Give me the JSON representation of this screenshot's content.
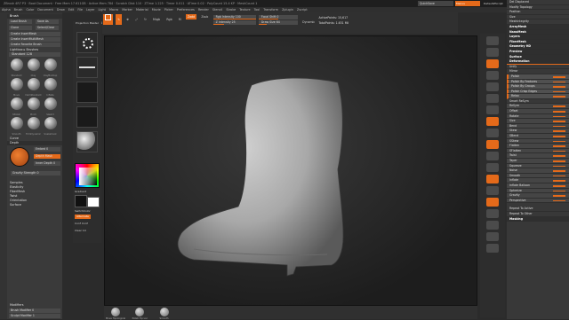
{
  "titlebar": {
    "text": "ZBrush 4R7 P3 · Boot Document · Free Mem 17.611GB · Active Mem 784 · Scratch Disk 110 · ZTime 1.225 · Timer 0.011 · ATime 0.02 · PolyCount 15.4 KP · MeshCount 1"
  },
  "top_right": {
    "quicksave": "QuickSave",
    "see_through": "See-through 0",
    "menus": "Menus",
    "default_zscript": "DefaultZScript"
  },
  "menubar": [
    "Alpha",
    "Brush",
    "Color",
    "Document",
    "Draw",
    "Edit",
    "File",
    "Layer",
    "Light",
    "Macro",
    "Marker",
    "Material",
    "Movie",
    "Picker",
    "Preferences",
    "Render",
    "Stencil",
    "Stroke",
    "Texture",
    "Tool",
    "Transform",
    "Zplugin",
    "Zscript"
  ],
  "brush_palette": {
    "title": "Brush",
    "buttons": [
      "Load Brush",
      "Save As",
      "Clone",
      "Select/Clear",
      "Create InsertMesh",
      "Create InsertMultiMesh",
      "Create Favorite Brush"
    ],
    "section": "Lightbox ▸ Brushes",
    "standard_label": "Standard 128",
    "thumbs": [
      "Standard",
      "Clay",
      "ClayBuildup",
      "Move",
      "DamStandard",
      "Inflate",
      "hPolish",
      "Pinch",
      "Slash3",
      "Smooth",
      "TrimDynamic",
      "Snakehook"
    ],
    "curve": "Curve",
    "depth": "Depth",
    "embed": "Embed 0",
    "depth_mask": "Depth Mask",
    "inner_depth": "Inner Depth 0",
    "gravity": "Gravity Strength 0",
    "sections": [
      "Samples",
      "Elasticity",
      "FiberMesh",
      "Twist",
      "Orientation",
      "Surface"
    ],
    "footer": [
      "Modifiers",
      "Brush Modifier 0",
      "Sculpt Modifier 1"
    ]
  },
  "tool_column": {
    "projection_master": "Projection Master",
    "lightbox": "LightBox",
    "gradient": "Gradient",
    "switchcolor": "SwitchColor",
    "alternate": "Alternate",
    "conf_conf": "Conf Conf",
    "clear": "Clear 10"
  },
  "toolbar": {
    "edit": "Edit",
    "draw": "Draw",
    "move": "Move",
    "scale": "Scale",
    "rotate": "Rotate",
    "mrgb": "Mrgb",
    "rgb": "Rgb",
    "m": "M",
    "zadd": "Zadd",
    "zsub": "Zsub",
    "rgb_intensity": "Rgb Intensity 100",
    "z_intensity": "Z Intensity 25",
    "focal_shift": "Focal Shift 0",
    "draw_size": "Draw Size 64",
    "dynamic": "Dynamic",
    "active_points": "ActivePoints: 15,617",
    "total_points": "TotalPoints: 1.631 Mil"
  },
  "bottombar": {
    "items": [
      "Move Topological",
      "Polish Tip Loc",
      "Smooth"
    ]
  },
  "right_icons": [
    "BPR",
    "SPix 3",
    "Scroll",
    "Zoom",
    "Actual",
    "AAHalf",
    "Persp",
    "Floor",
    "Local",
    "LSym",
    "Frame",
    "Move",
    "Scale",
    "Rotate",
    "Line Fill",
    "PolyF",
    "Transp",
    "Ghost",
    "Solo",
    "Xpose"
  ],
  "right_panel": {
    "top": [
      "Del Displaced",
      "Modify Topology",
      "Position",
      "Size",
      "MeshIntegrity"
    ],
    "sections": [
      "ArrayMesh",
      "NanoMesh",
      "Layers",
      "FiberMesh",
      "Geometry HD",
      "Preview",
      "Surface",
      "Deformation"
    ],
    "deformation": [
      "Unify",
      "Mirror",
      "Polish",
      "Polish By Features",
      "Polish By Groups",
      "Polish Crisp Edges",
      "Relax",
      "Smart ReSym",
      "ReSym",
      "Offset",
      "Rotate",
      "Size",
      "Bend",
      "Skew",
      "SBend",
      "SSkew",
      "Flatten",
      "SFlatten",
      "Twist",
      "Taper",
      "Squeeze",
      "Noise",
      "Smooth",
      "Inflate",
      "Inflate Balloon",
      "Spherize",
      "Gravity",
      "Perspective"
    ],
    "footer": [
      "Repeat To Active",
      "Repeat To Other",
      "Masking"
    ]
  }
}
